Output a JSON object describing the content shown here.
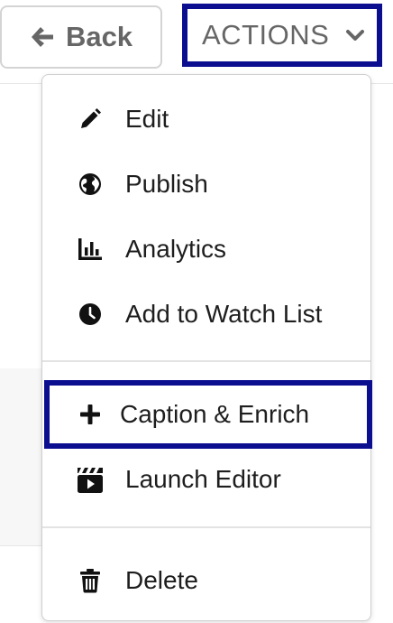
{
  "header": {
    "back_label": "Back",
    "actions_label": "ACTIONS"
  },
  "menu": {
    "items": [
      {
        "label": "Edit",
        "icon": "pencil-icon"
      },
      {
        "label": "Publish",
        "icon": "globe-icon"
      },
      {
        "label": "Analytics",
        "icon": "bar-chart-icon"
      },
      {
        "label": "Add to Watch List",
        "icon": "clock-icon"
      },
      {
        "label": "Caption & Enrich",
        "icon": "plus-icon"
      },
      {
        "label": "Launch Editor",
        "icon": "clapperboard-icon"
      },
      {
        "label": "Delete",
        "icon": "trash-icon"
      }
    ],
    "focused_label": "Caption & Enrich"
  },
  "colors": {
    "focus_outline": "#0b0e8f",
    "button_text": "#666666",
    "menu_text": "#1e1e1e",
    "icon": "#111111"
  }
}
